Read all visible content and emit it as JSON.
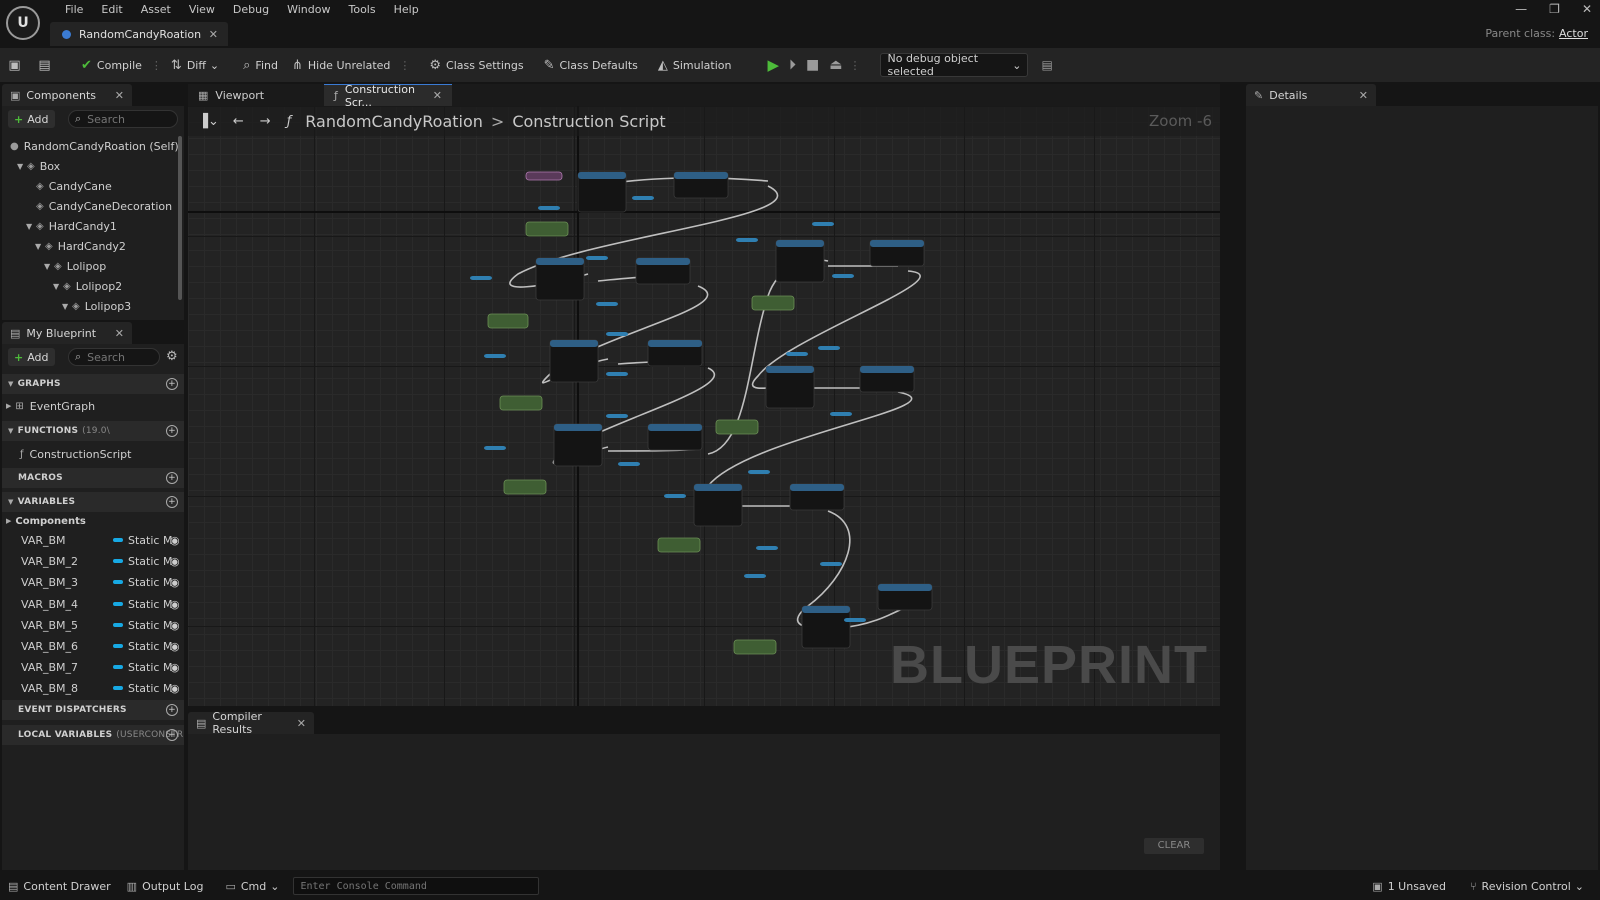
{
  "app": {
    "logo": "U",
    "menu": [
      "File",
      "Edit",
      "Asset",
      "View",
      "Debug",
      "Window",
      "Tools",
      "Help"
    ],
    "doc_tab": "RandomCandyRoation",
    "doc_tab_close": "✕",
    "window_controls": [
      "—",
      "❐",
      "✕"
    ],
    "parent_class_label": "Parent class:",
    "parent_class_value": "Actor"
  },
  "toolbar": {
    "compile": "Compile",
    "diff": "Diff",
    "find": "Find",
    "hide_unrelated": "Hide Unrelated",
    "class_settings": "Class Settings",
    "class_defaults": "Class Defaults",
    "simulation": "Simulation",
    "debug_select": "No debug object selected"
  },
  "components": {
    "tab": "Components",
    "add": "Add",
    "search_placeholder": "Search",
    "tree": [
      {
        "label": "RandomCandyRoation (Self)",
        "depth": 0,
        "expander": ""
      },
      {
        "label": "Box",
        "depth": 1,
        "expander": "▼"
      },
      {
        "label": "CandyCane",
        "depth": 2,
        "expander": ""
      },
      {
        "label": "CandyCaneDecoration",
        "depth": 2,
        "expander": ""
      },
      {
        "label": "HardCandy1",
        "depth": 2,
        "expander": "▼"
      },
      {
        "label": "HardCandy2",
        "depth": 3,
        "expander": "▼"
      },
      {
        "label": "Lolipop",
        "depth": 4,
        "expander": "▼"
      },
      {
        "label": "Lolipop2",
        "depth": 5,
        "expander": "▼"
      },
      {
        "label": "Lolipop3",
        "depth": 6,
        "expander": "▼"
      }
    ]
  },
  "blueprint": {
    "tab": "My Blueprint",
    "add": "Add",
    "search_placeholder": "Search",
    "graphs_title": "GRAPHS",
    "event_graph": "EventGraph",
    "functions_title": "FUNCTIONS",
    "functions_count": "(19.0\\",
    "construction_script": "ConstructionScript",
    "macros_title": "MACROS",
    "variables_title": "VARIABLES",
    "components_group": "Components",
    "variables": [
      {
        "name": "VAR_BM",
        "type": "Static M"
      },
      {
        "name": "VAR_BM_2",
        "type": "Static M"
      },
      {
        "name": "VAR_BM_3",
        "type": "Static M"
      },
      {
        "name": "VAR_BM_4",
        "type": "Static M"
      },
      {
        "name": "VAR_BM_5",
        "type": "Static M"
      },
      {
        "name": "VAR_BM_6",
        "type": "Static M"
      },
      {
        "name": "VAR_BM_7",
        "type": "Static M"
      },
      {
        "name": "VAR_BM_8",
        "type": "Static M"
      }
    ],
    "event_dispatchers_title": "EVENT DISPATCHERS",
    "local_variables_title": "LOCAL VARIABLES",
    "local_variables_sub": "(USERCONSTR"
  },
  "graph": {
    "tabs": [
      "Viewport",
      "Construction Scr..."
    ],
    "breadcrumb_root": "RandomCandyRoation",
    "breadcrumb_leaf": "Construction Script",
    "zoom": "Zoom -6",
    "watermark": "BLUEPRINT"
  },
  "details": {
    "tab": "Details"
  },
  "compiler": {
    "tab": "Compiler Results",
    "clear": "CLEAR"
  },
  "status": {
    "content_drawer": "Content Drawer",
    "output_log": "Output Log",
    "cmd": "Cmd",
    "console_placeholder": "Enter Console Command",
    "unsaved": "1 Unsaved",
    "revision_control": "Revision Control"
  },
  "colors": {
    "accent": "#3b7bd2",
    "play": "#4dbb3a",
    "var_pill": "#17a9e4",
    "exec_node": "#4a6b35",
    "pure_node": "#2f7fb1"
  }
}
